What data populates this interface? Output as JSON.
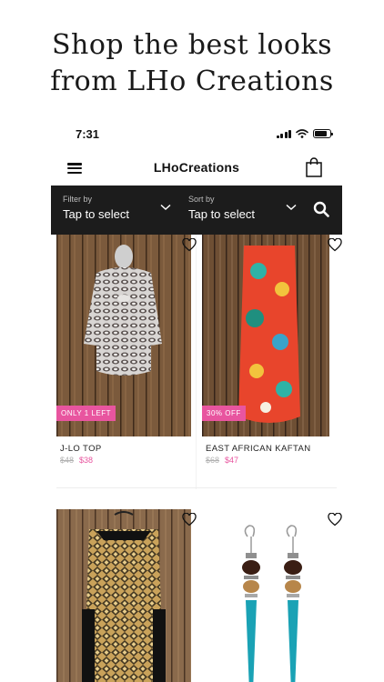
{
  "headline": {
    "line1": "Shop the best looks",
    "line2": "from LHo Creations"
  },
  "status": {
    "time": "7:31",
    "battery_level": 0.8
  },
  "appbar": {
    "brand": "LHoCreations",
    "menu_icon": "hamburger-menu-icon",
    "cart_icon": "shopping-bag-icon"
  },
  "filter": {
    "label": "Filter by",
    "value": "Tap to select"
  },
  "sort": {
    "label": "Sort by",
    "value": "Tap to select"
  },
  "products": [
    {
      "name": "J-LO TOP",
      "old_price": "$48",
      "price": "$38",
      "badge": "ONLY 1 LEFT"
    },
    {
      "name": "EAST AFRICAN KAFTAN",
      "old_price": "$68",
      "price": "$47",
      "badge": "30% OFF"
    },
    {
      "name": "",
      "old_price": "",
      "price": "",
      "badge": ""
    },
    {
      "name": "",
      "old_price": "",
      "price": "",
      "badge": ""
    }
  ],
  "colors": {
    "accent_pink": "#e8559f",
    "filter_bar": "#1c1c1c"
  }
}
